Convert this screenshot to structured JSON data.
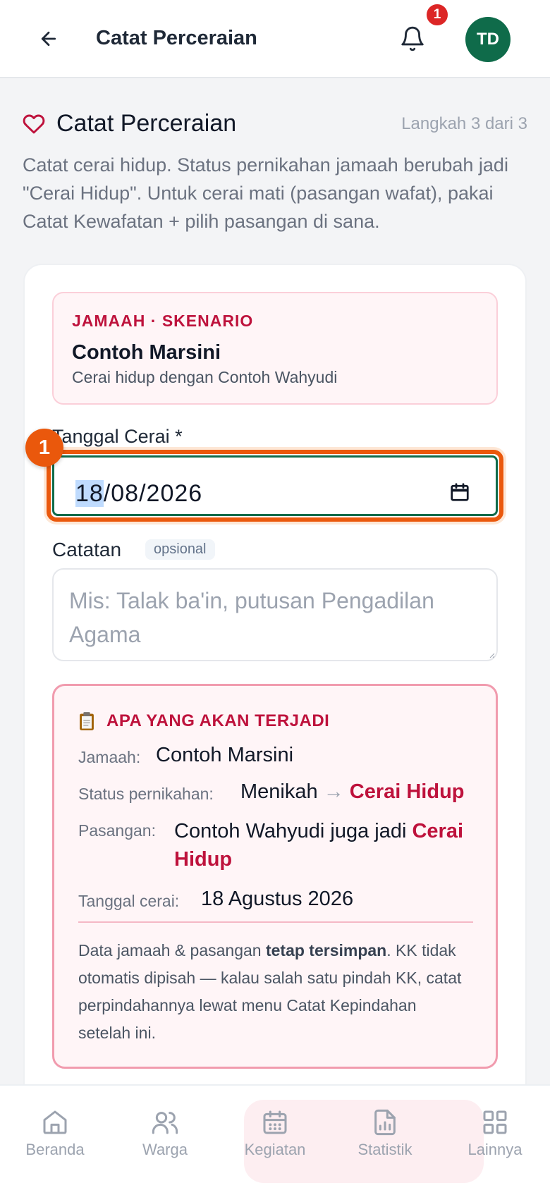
{
  "header": {
    "title": "Catat Perceraian",
    "notification_count": "1",
    "avatar_initials": "TD"
  },
  "section": {
    "title": "Catat Perceraian",
    "step_text": "Langkah 3 dari 3",
    "intro": "Catat cerai hidup. Status pernikahan jamaah berubah jadi \"Cerai Hidup\". Untuk cerai mati (pasangan wafat), pakai Catat Kewafatan + pilih pasangan di sana."
  },
  "scenario": {
    "label": "JAMAAH · SKENARIO",
    "name": "Contoh Marsini",
    "description": "Cerai hidup dengan Contoh Wahyudi"
  },
  "form": {
    "date_label": "Tanggal Cerai *",
    "step_marker": "1",
    "date_day": "18",
    "date_rest": "/08/2026",
    "notes_label": "Catatan",
    "notes_optional": "opsional",
    "notes_placeholder": "Mis: Talak ba'in, putusan Pengadilan Agama",
    "notes_value": ""
  },
  "outcome": {
    "title": "APA YANG AKAN TERJADI",
    "jamaah_label": "Jamaah:",
    "jamaah_value": "Contoh Marsini",
    "status_label": "Status pernikahan:",
    "status_from": "Menikah",
    "status_arrow": "→",
    "status_to": "Cerai Hidup",
    "partner_label": "Pasangan:",
    "partner_text": "Contoh Wahyudi juga jadi",
    "partner_status_1": "Cerai",
    "partner_status_2": "Hidup",
    "date_label": "Tanggal cerai:",
    "date_value": "18 Agustus 2026",
    "note_1": "Data jamaah & pasangan ",
    "note_bold": "tetap tersimpan",
    "note_2": ". KK tidak otomatis dipisah — kalau salah satu pindah KK, catat perpindahannya lewat menu Catat Kepindahan setelah ini."
  },
  "nav": {
    "items": [
      {
        "label": "Beranda",
        "icon": "home-icon"
      },
      {
        "label": "Warga",
        "icon": "users-icon"
      },
      {
        "label": "Kegiatan",
        "icon": "calendar-icon"
      },
      {
        "label": "Statistik",
        "icon": "chart-icon"
      },
      {
        "label": "Lainnya",
        "icon": "grid-icon"
      }
    ]
  },
  "colors": {
    "brand_green": "#0f6b4a",
    "accent_rose": "#be123c",
    "focus_orange": "#ea580c",
    "badge_red": "#dc2626"
  }
}
